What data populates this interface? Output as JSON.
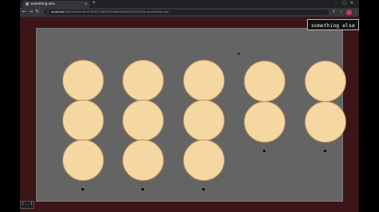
{
  "browser": {
    "tab_title": "something else",
    "tab_close": "×",
    "new_tab": "+",
    "url_host": "localhost",
    "url_rest": ":8000/index.html?jSHD7c4802590a8af43c6e2b3425f3ce something else",
    "window_controls": [
      "–",
      "▢",
      "✕"
    ]
  },
  "game": {
    "tooltip": "something else",
    "status_chip": "[...]",
    "cookie_color": "#f5d7a1",
    "background_color": "#3b1518",
    "board_color": "#646464",
    "columns": [
      {
        "cookies": 3,
        "marker": true
      },
      {
        "cookies": 3,
        "marker": true
      },
      {
        "cookies": 3,
        "marker": true
      },
      {
        "cookies": 2,
        "marker": true
      },
      {
        "cookies": 2,
        "marker": true
      }
    ]
  }
}
